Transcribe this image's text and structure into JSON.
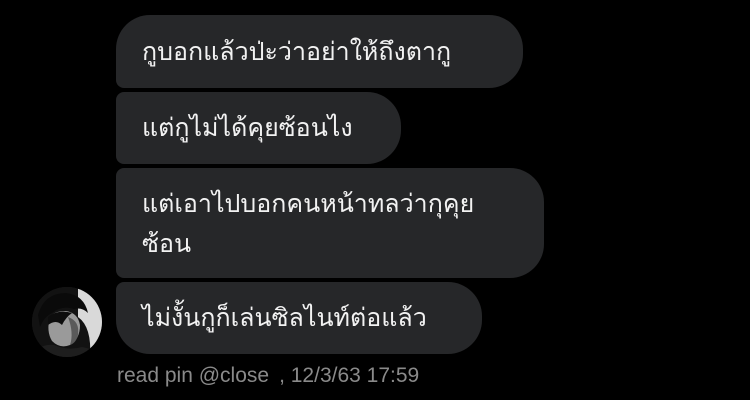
{
  "messages": [
    {
      "text": "กูบอกแล้วป่ะว่าอย่าให้ถึงตากู"
    },
    {
      "text": "แต่กูไม่ได้คุยซ้อนไง"
    },
    {
      "text": "แต่เอาไปบอกคนหน้าทลว่ากุคุย ซ้อน"
    },
    {
      "text": "ไม่งั้นกูก็เล่นซิลไนท์ต่อแล้ว"
    }
  ],
  "meta": {
    "read_label": "read pin @close",
    "timestamp": ", 12/3/63 17:59"
  },
  "colors": {
    "background": "#000000",
    "bubble": "#262729",
    "text": "#f2f2f2",
    "meta_text": "#8a8a8a"
  },
  "icons": {
    "avatar": "user-avatar"
  }
}
